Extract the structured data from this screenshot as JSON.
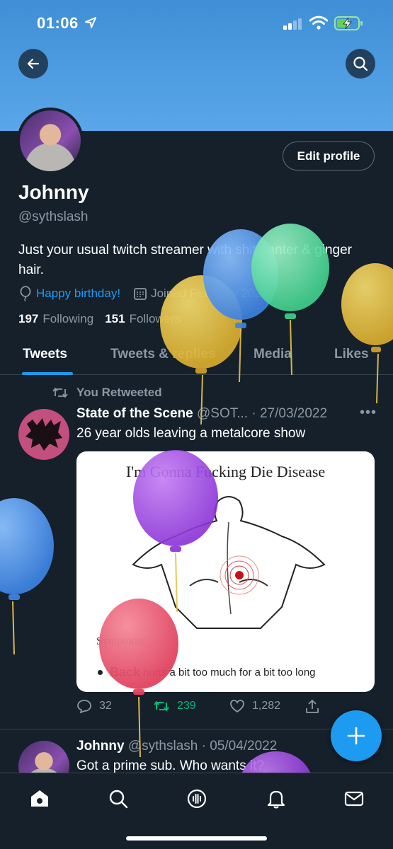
{
  "status_bar": {
    "time": "01:06"
  },
  "profile": {
    "name": "Johnny",
    "handle": "@sythslash",
    "edit_label": "Edit profile",
    "bio": "Just your usual twitch streamer with shit banter & ginger hair.",
    "birthday": "Happy birthday!",
    "joined": "Joined February 2020",
    "following_count": "197",
    "following_label": "Following",
    "followers_count": "151",
    "followers_label": "Followers"
  },
  "tabs": [
    "Tweets",
    "Tweets & replies",
    "Media",
    "Likes"
  ],
  "tweets": [
    {
      "retweet_label": "You Retweeted",
      "author": "State of the Scene",
      "handle_date": "@SOT... · 27/03/2022",
      "text": "26 year olds leaving a metalcore show",
      "media": {
        "title": "I'm Gonna Fucking Die Disease",
        "symptoms": "Symptoms:",
        "bullet_bold": "Back",
        "bullet_text": "hurts a bit too much for a bit too long"
      },
      "replies": "32",
      "retweets": "239",
      "likes": "1,282"
    },
    {
      "author": "Johnny",
      "handle_date": "@sythslash · 05/04/2022",
      "text": "Got a prime sub. Who wants it?"
    }
  ],
  "colors": {
    "accent": "#1d9bf0",
    "background": "#15202b",
    "retweet_green": "#00ba7c",
    "muted": "#8b98a5"
  },
  "icons": {
    "back": "arrow-left-icon",
    "search": "search-icon",
    "compose": "plus-icon",
    "nav": [
      "home-icon",
      "search-icon",
      "spaces-icon",
      "bell-icon",
      "mail-icon"
    ]
  }
}
